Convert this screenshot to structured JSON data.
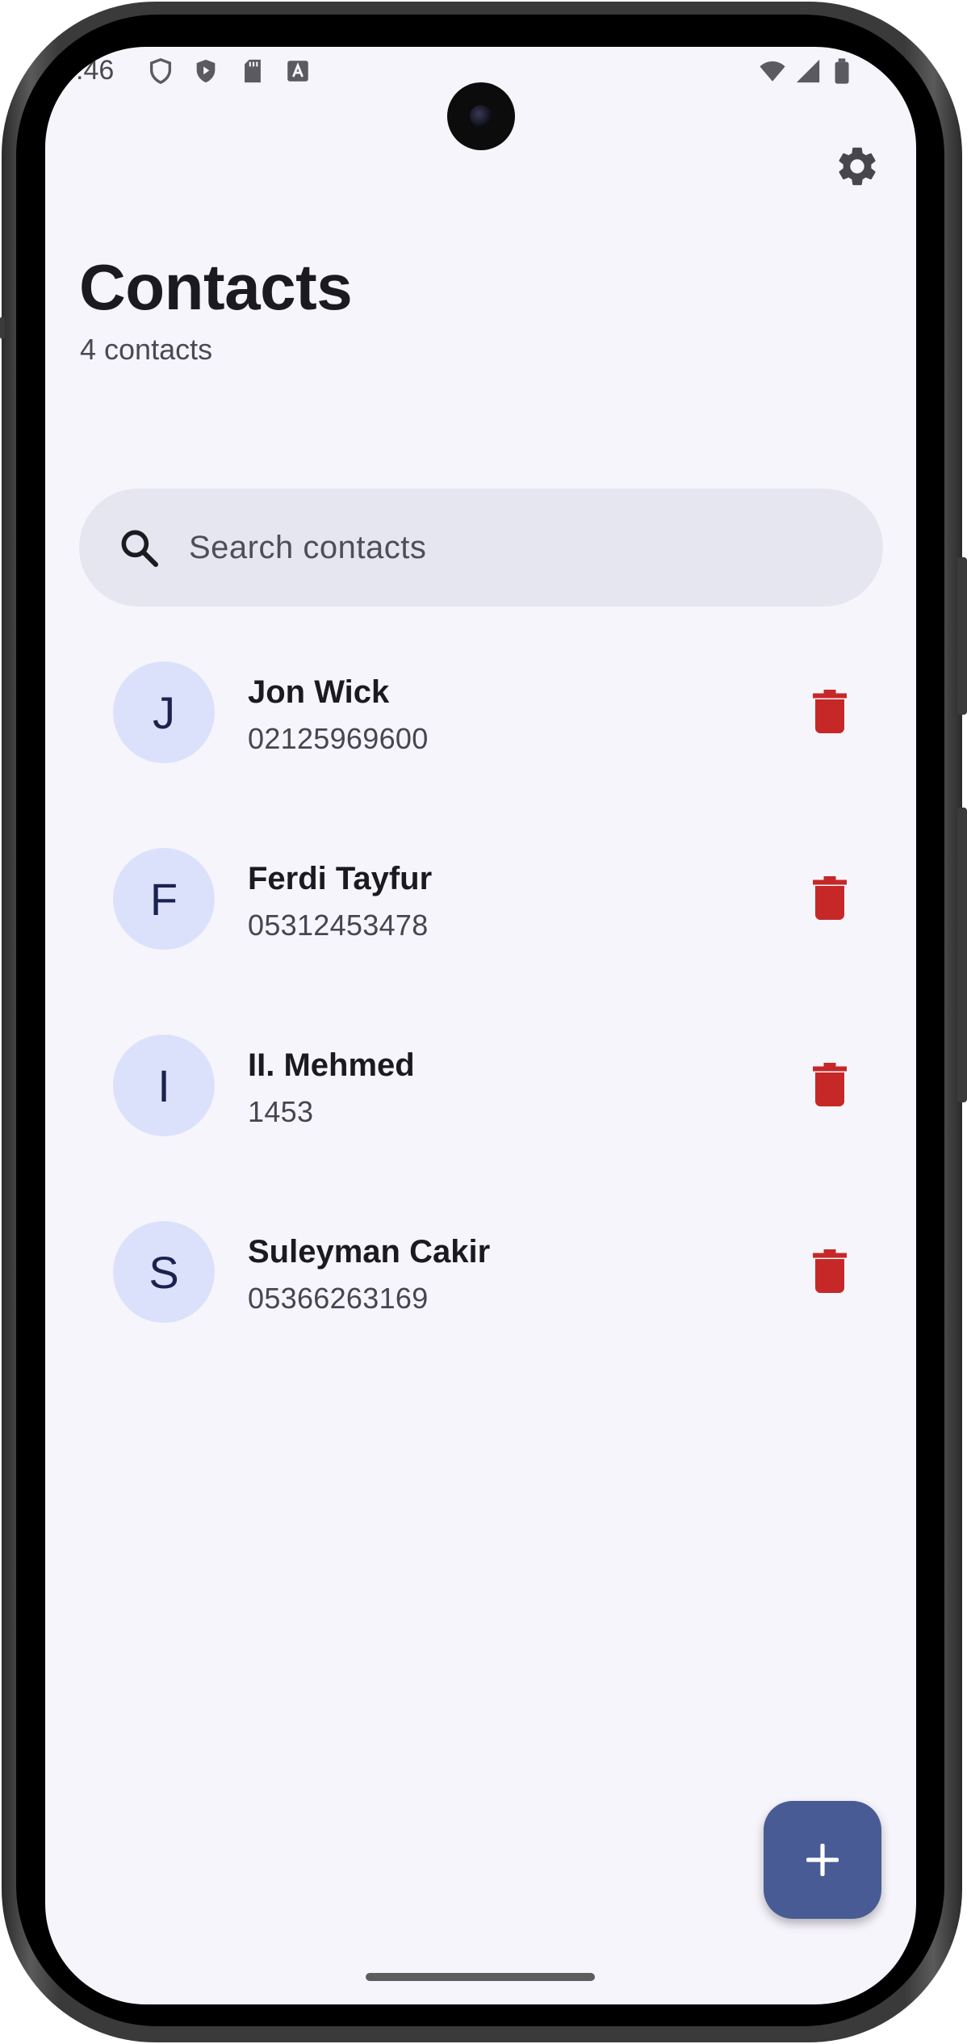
{
  "status_bar": {
    "time": ":46"
  },
  "header": {
    "title": "Contacts",
    "subtitle": "4 contacts"
  },
  "search": {
    "placeholder": "Search contacts",
    "value": ""
  },
  "contacts": [
    {
      "initial": "J",
      "name": "Jon Wick",
      "phone": "02125969600"
    },
    {
      "initial": "F",
      "name": "Ferdi Tayfur",
      "phone": "05312453478"
    },
    {
      "initial": "I",
      "name": "II. Mehmed",
      "phone": "1453"
    },
    {
      "initial": "S",
      "name": "Suleyman Cakir",
      "phone": "05366263169"
    }
  ],
  "icons": {
    "settings": "gear-icon",
    "search": "search-icon",
    "delete": "trash-icon",
    "add": "plus-icon"
  },
  "colors": {
    "background": "#f7f5fc",
    "avatar_bg": "#dce1fb",
    "delete": "#c62828",
    "fab": "#485b94",
    "search_bg": "#e6e6f0"
  }
}
